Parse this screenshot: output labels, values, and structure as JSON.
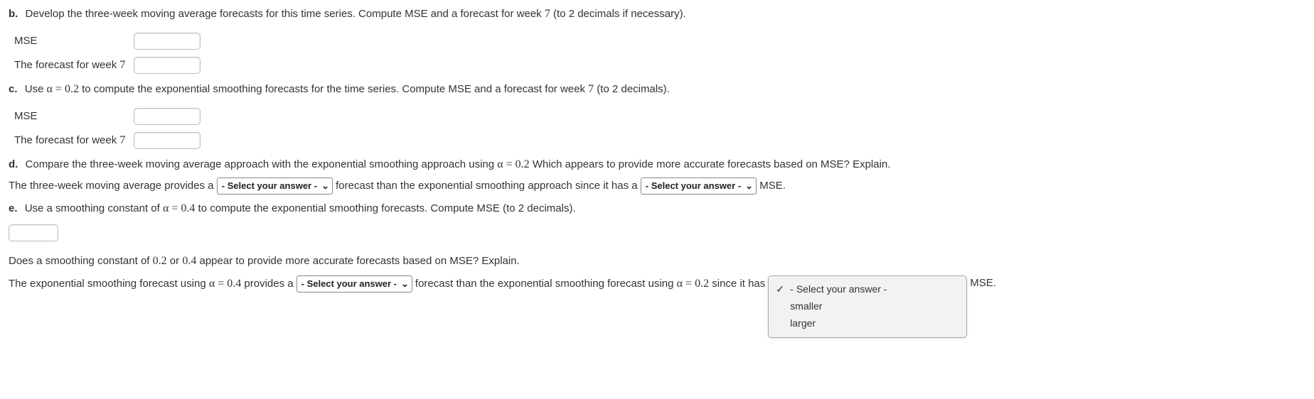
{
  "b": {
    "label": "b.",
    "prompt_pre": "Develop the three-week moving average forecasts for this time series. Compute MSE and a forecast for week ",
    "week_num": "7",
    "prompt_post": " (to 2 decimals if necessary).",
    "fields": {
      "mse_label": "MSE",
      "forecast_pre": "The forecast for week ",
      "forecast_week": "7"
    }
  },
  "c": {
    "label": "c.",
    "txt1": "Use ",
    "alpha_eq": "α = 0.2",
    "txt2": " to compute the exponential smoothing forecasts for the time series. Compute MSE and a forecast for week ",
    "week_num": "7",
    "txt3": " (to 2 decimals).",
    "fields": {
      "mse_label": "MSE",
      "forecast_pre": "The forecast for week ",
      "forecast_week": "7"
    }
  },
  "d": {
    "label": "d.",
    "txt1": "Compare the three-week moving average approach with the exponential smoothing approach using ",
    "alpha_eq": "α = 0.2",
    "txt2": " Which appears to provide more accurate forecasts based on MSE? Explain.",
    "answer": {
      "t1": "The three-week moving average provides a",
      "sel1": "- Select your answer -",
      "t2": "forecast than the exponential smoothing approach since it has a",
      "sel2": "- Select your answer -",
      "t3": "MSE."
    }
  },
  "e": {
    "label": "e.",
    "txt1": "Use a smoothing constant of ",
    "alpha_eq": "α = 0.4",
    "txt2": " to compute the exponential smoothing forecasts. Compute MSE (to 2 decimals).",
    "q2": {
      "t1": "Does a smoothing constant of ",
      "v1": "0.2",
      "t2": " or ",
      "v2": "0.4",
      "t3": " appear to provide more accurate forecasts based on MSE? Explain."
    },
    "answer": {
      "t1": "The exponential smoothing forecast using ",
      "alpha1": "α = 0.4",
      "t2": " provides a",
      "sel1": "- Select your answer -",
      "t3": "forecast than the exponential smoothing forecast using ",
      "alpha2": "α = 0.2",
      "t4": " since it has",
      "dropdown": {
        "opt_selected": "- Select your answer -",
        "opt1": "smaller",
        "opt2": "larger"
      },
      "t5": "MSE."
    }
  }
}
